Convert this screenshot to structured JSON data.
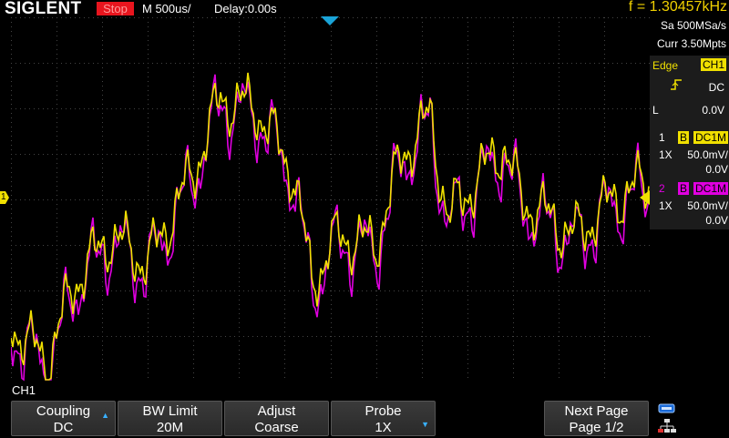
{
  "topbar": {
    "logo": "SIGLENT",
    "run_state": "Stop",
    "timebase": "M 500us/",
    "delay": "Delay:0.00s",
    "frequency": "f = 1.30457kHz"
  },
  "acquisition": {
    "sample_rate": "Sa 500MSa/s",
    "memory": "Curr 3.50Mpts"
  },
  "trigger": {
    "type": "Edge",
    "source": "CH1",
    "slope_icon": "rising-edge-icon",
    "coupling": "DC",
    "level_label": "L",
    "level": "0.0V"
  },
  "channels": [
    {
      "number": "1",
      "bw_badge": "B",
      "coupling": "DC1M",
      "probe": "1X",
      "scale": "50.0mV/",
      "offset": "0.0V",
      "color": "#f0e000"
    },
    {
      "number": "2",
      "bw_badge": "B",
      "coupling": "DC1M",
      "probe": "1X",
      "scale": "50.0mV/",
      "offset": "0.0V",
      "color": "#e000e0"
    }
  ],
  "active_channel_label": "CH1",
  "ch1_marker": "1",
  "softkeys": [
    {
      "title": "Coupling",
      "value": "DC",
      "arrow": "up"
    },
    {
      "title": "BW Limit",
      "value": "20M"
    },
    {
      "title": "Adjust",
      "value": "Coarse"
    },
    {
      "title": "Probe",
      "value": "1X",
      "arrow": "down"
    },
    {
      "title": "Next Page",
      "value": "Page 1/2"
    }
  ],
  "icons": {
    "usb": "usb-icon",
    "network": "network-icon"
  },
  "colors": {
    "ch1": "#f0e000",
    "ch2": "#e000e0",
    "trigger_marker": "#1aa4d8",
    "stop": "#e8151e"
  }
}
